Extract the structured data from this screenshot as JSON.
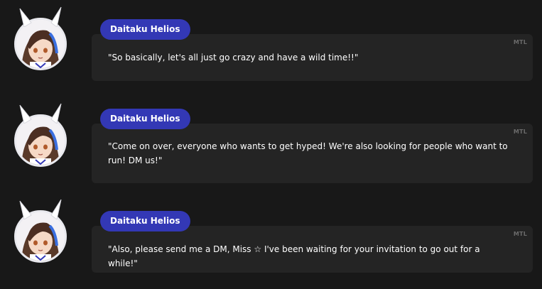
{
  "messages": [
    {
      "speaker": "Daitaku Helios",
      "tag": "MTL",
      "text": "\"So basically, let's all just go crazy and have a wild time!!\"",
      "avatar_icon": "daitaku-helios-avatar"
    },
    {
      "speaker": "Daitaku Helios",
      "tag": "MTL",
      "text": "\"Come on over, everyone who wants to get hyped! We're also looking for people who want to run! DM us!\"",
      "avatar_icon": "daitaku-helios-avatar"
    },
    {
      "speaker": "Daitaku Helios",
      "tag": "MTL",
      "text": "\"Also, please send me a DM, Miss ☆ I've been waiting for your invitation to go out for a while!\"",
      "avatar_icon": "daitaku-helios-avatar"
    }
  ],
  "colors": {
    "background": "#181818",
    "bubble": "#242424",
    "name_pill": "#3338b5",
    "tag": "#6b6b6b"
  }
}
